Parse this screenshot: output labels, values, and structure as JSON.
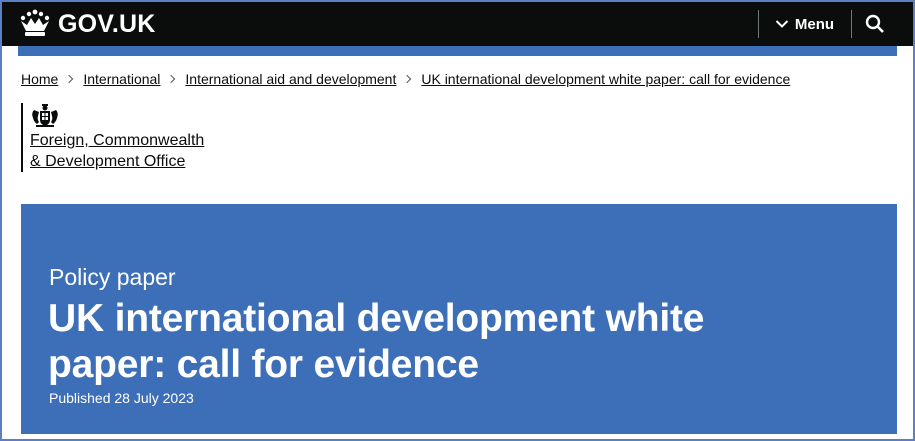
{
  "header": {
    "logo_text": "GOV.UK",
    "logo_icon": "crown-icon",
    "menu_label": "Menu",
    "menu_icon": "chevron-down-icon",
    "search_icon": "search-icon"
  },
  "breadcrumb": {
    "items": [
      {
        "label": "Home"
      },
      {
        "label": "International"
      },
      {
        "label": "International aid and development"
      },
      {
        "label": "UK international development white paper: call for evidence"
      }
    ]
  },
  "organisation": {
    "crest_icon": "royal-coat-of-arms-icon",
    "name_line1": "Foreign, Commonwealth",
    "name_line2": "& Development Office"
  },
  "masthead": {
    "document_type": "Policy paper",
    "title": "UK international development white paper: call for evidence",
    "published": "Published 28 July 2023"
  },
  "colors": {
    "header_bg": "#0b0c0c",
    "brand_blue": "#3d6fb8",
    "text": "#0b0c0c",
    "frame_border": "#5b7fc3"
  }
}
